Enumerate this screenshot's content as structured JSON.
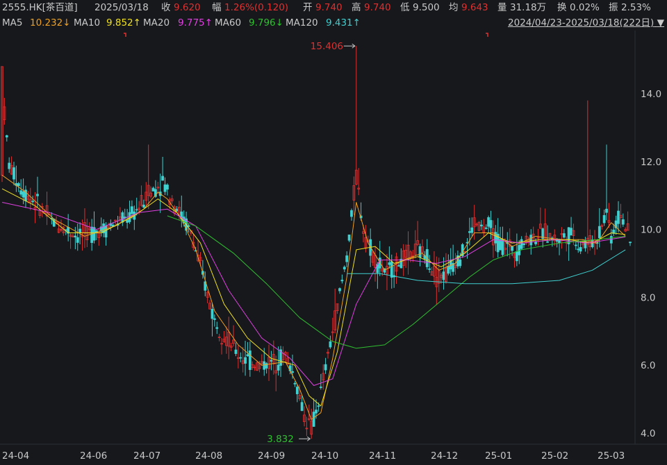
{
  "header": {
    "code": "2555.HK[茶百道]",
    "date": "2025/03/18",
    "close_label": "收",
    "close": "9.620",
    "change_label": "幅",
    "change": "1.26%(0.120)",
    "open_label": "开",
    "open": "9.740",
    "high_label": "高",
    "high": "9.740",
    "low_label": "低",
    "low": "9.500",
    "avg_label": "均",
    "avg": "9.643",
    "vol_label": "量",
    "vol": "31.18万",
    "turnover_label": "换",
    "turnover": "0.02%",
    "amp_label": "振",
    "amp": "2.53%"
  },
  "ma_legend": [
    {
      "label": "MA5",
      "value": "10.232↓",
      "color": "#f0a020"
    },
    {
      "label": "MA10",
      "value": "9.852↑",
      "color": "#f0e020"
    },
    {
      "label": "MA20",
      "value": "9.775↑",
      "color": "#e040e0"
    },
    {
      "label": "MA60",
      "value": "9.796↓",
      "color": "#30c030"
    },
    {
      "label": "MA120",
      "value": "9.431↑",
      "color": "#40d0d0"
    }
  ],
  "range": "2024/04/23-2025/03/18(222日)",
  "colors": {
    "up": "#e03030",
    "down": "#40d0d0",
    "bg": "#16181c"
  },
  "chart_data": {
    "type": "candlestick",
    "x_ticks": [
      "24-04",
      "24-06",
      "24-07",
      "24-08",
      "24-09",
      "24-10",
      "24-11",
      "24-12",
      "25-01",
      "25-02",
      "25-03"
    ],
    "y_ticks": [
      "4.0",
      "6.0",
      "8.0",
      "10.0",
      "12.0",
      "14.0"
    ],
    "ylim": [
      3.6,
      15.6
    ],
    "annotations": [
      {
        "text": "15.406",
        "value": 15.406,
        "date": "24-10"
      },
      {
        "text": "3.832",
        "value": 3.832,
        "date": "24-09"
      }
    ],
    "price_path": [
      [
        0,
        14.2
      ],
      [
        3,
        11.9
      ],
      [
        8,
        11.2
      ],
      [
        14,
        10.8
      ],
      [
        22,
        10.2
      ],
      [
        32,
        9.8
      ],
      [
        42,
        10.0
      ],
      [
        55,
        10.4
      ],
      [
        62,
        11.0
      ],
      [
        68,
        11.4
      ],
      [
        72,
        10.9
      ],
      [
        76,
        10.4
      ],
      [
        80,
        9.9
      ],
      [
        85,
        8.6
      ],
      [
        90,
        7.3
      ],
      [
        95,
        6.8
      ],
      [
        100,
        6.3
      ],
      [
        108,
        6.0
      ],
      [
        115,
        6.1
      ],
      [
        120,
        6.3
      ],
      [
        124,
        5.6
      ],
      [
        128,
        4.5
      ],
      [
        131,
        4.1
      ],
      [
        135,
        5.2
      ],
      [
        140,
        7.0
      ],
      [
        146,
        9.2
      ],
      [
        150,
        11.6
      ],
      [
        153,
        10.0
      ],
      [
        158,
        9.1
      ],
      [
        163,
        8.7
      ],
      [
        168,
        9.0
      ],
      [
        172,
        9.2
      ],
      [
        176,
        9.4
      ],
      [
        180,
        9.2
      ],
      [
        184,
        8.6
      ],
      [
        188,
        8.7
      ],
      [
        192,
        9.1
      ],
      [
        196,
        9.4
      ],
      [
        200,
        10.2
      ],
      [
        204,
        10.0
      ],
      [
        206,
        10.1
      ],
      [
        210,
        9.6
      ],
      [
        214,
        9.5
      ],
      [
        218,
        9.4
      ],
      [
        222,
        9.7
      ],
      [
        226,
        9.8
      ],
      [
        230,
        9.9
      ],
      [
        234,
        9.7
      ],
      [
        238,
        9.8
      ],
      [
        242,
        9.9
      ],
      [
        244,
        9.5
      ],
      [
        248,
        9.6
      ],
      [
        252,
        9.7
      ],
      [
        256,
        10.6
      ],
      [
        258,
        9.8
      ],
      [
        262,
        10.5
      ],
      [
        266,
        9.6
      ]
    ],
    "ma_paths": {
      "MA5": [
        [
          0,
          11.6
        ],
        [
          10,
          11.1
        ],
        [
          22,
          10.3
        ],
        [
          35,
          9.8
        ],
        [
          48,
          10.1
        ],
        [
          60,
          10.6
        ],
        [
          66,
          11.1
        ],
        [
          70,
          10.9
        ],
        [
          76,
          10.3
        ],
        [
          82,
          9.4
        ],
        [
          90,
          7.6
        ],
        [
          100,
          6.6
        ],
        [
          110,
          6.0
        ],
        [
          120,
          6.1
        ],
        [
          126,
          5.3
        ],
        [
          131,
          4.4
        ],
        [
          135,
          4.6
        ],
        [
          140,
          6.2
        ],
        [
          146,
          8.6
        ],
        [
          150,
          10.8
        ],
        [
          155,
          9.6
        ],
        [
          162,
          8.8
        ],
        [
          170,
          9.1
        ],
        [
          178,
          9.3
        ],
        [
          185,
          8.8
        ],
        [
          192,
          9.0
        ],
        [
          200,
          9.9
        ],
        [
          208,
          9.9
        ],
        [
          216,
          9.5
        ],
        [
          226,
          9.8
        ],
        [
          236,
          9.7
        ],
        [
          246,
          9.7
        ],
        [
          252,
          9.6
        ],
        [
          258,
          10.2
        ],
        [
          264,
          9.8
        ]
      ],
      "MA10": [
        [
          0,
          11.2
        ],
        [
          14,
          10.7
        ],
        [
          28,
          9.9
        ],
        [
          42,
          9.9
        ],
        [
          56,
          10.4
        ],
        [
          66,
          10.9
        ],
        [
          74,
          10.5
        ],
        [
          84,
          9.6
        ],
        [
          94,
          7.8
        ],
        [
          104,
          6.8
        ],
        [
          114,
          6.2
        ],
        [
          124,
          6.0
        ],
        [
          130,
          5.1
        ],
        [
          135,
          4.8
        ],
        [
          142,
          6.4
        ],
        [
          150,
          9.4
        ],
        [
          158,
          9.5
        ],
        [
          166,
          9.0
        ],
        [
          176,
          9.2
        ],
        [
          186,
          8.9
        ],
        [
          196,
          9.3
        ],
        [
          206,
          9.9
        ],
        [
          216,
          9.6
        ],
        [
          228,
          9.7
        ],
        [
          240,
          9.7
        ],
        [
          250,
          9.6
        ],
        [
          258,
          9.9
        ],
        [
          264,
          9.85
        ]
      ],
      "MA20": [
        [
          0,
          10.8
        ],
        [
          20,
          10.5
        ],
        [
          40,
          10.0
        ],
        [
          58,
          10.5
        ],
        [
          70,
          10.6
        ],
        [
          82,
          10.1
        ],
        [
          96,
          8.2
        ],
        [
          110,
          6.8
        ],
        [
          122,
          6.2
        ],
        [
          132,
          5.4
        ],
        [
          140,
          5.6
        ],
        [
          150,
          7.8
        ],
        [
          160,
          9.1
        ],
        [
          172,
          9.1
        ],
        [
          184,
          9.0
        ],
        [
          196,
          9.2
        ],
        [
          208,
          9.7
        ],
        [
          220,
          9.6
        ],
        [
          234,
          9.7
        ],
        [
          248,
          9.6
        ],
        [
          264,
          9.78
        ]
      ],
      "MA60": [
        [
          70,
          10.4
        ],
        [
          82,
          10.1
        ],
        [
          98,
          9.3
        ],
        [
          112,
          8.4
        ],
        [
          126,
          7.4
        ],
        [
          140,
          6.7
        ],
        [
          150,
          6.5
        ],
        [
          162,
          6.6
        ],
        [
          174,
          7.2
        ],
        [
          186,
          7.9
        ],
        [
          198,
          8.6
        ],
        [
          208,
          9.1
        ],
        [
          220,
          9.4
        ],
        [
          236,
          9.6
        ],
        [
          252,
          9.7
        ],
        [
          264,
          9.8
        ]
      ],
      "MA120": [
        [
          146,
          8.7
        ],
        [
          160,
          8.7
        ],
        [
          176,
          8.5
        ],
        [
          196,
          8.4
        ],
        [
          216,
          8.4
        ],
        [
          236,
          8.5
        ],
        [
          250,
          8.8
        ],
        [
          264,
          9.4
        ]
      ]
    }
  }
}
